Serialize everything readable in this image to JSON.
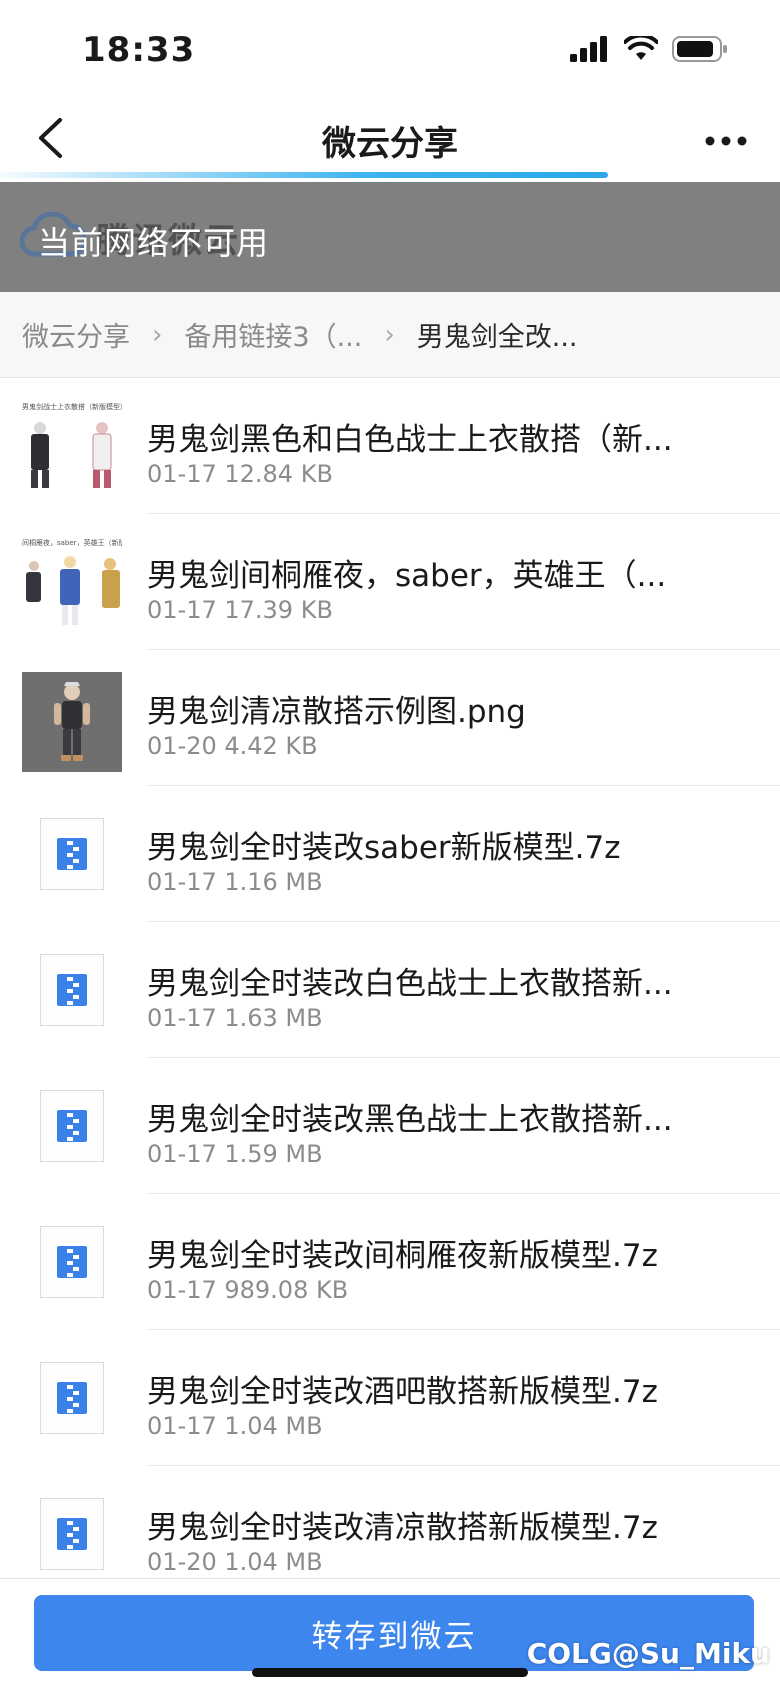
{
  "status_bar": {
    "time": "18:33"
  },
  "nav": {
    "title": "微云分享"
  },
  "loading_progress": 0.78,
  "banner": {
    "watermark": "腾讯微云",
    "message": "当前网络不可用"
  },
  "breadcrumb": {
    "items": [
      "微云分享",
      "备用链接3（...",
      "男鬼剑全改..."
    ],
    "separator": "›"
  },
  "files": [
    {
      "name": "男鬼剑黑色和白色战士上衣散搭（新...",
      "meta": "01-17 12.84 KB",
      "icon": "image-thumbnail",
      "thumb_caption": "男鬼剑战士上衣散搭（新版模型）"
    },
    {
      "name": "男鬼剑间桐雁夜，saber，英雄王（...",
      "meta": "01-17 17.39 KB",
      "icon": "image-thumbnail",
      "thumb_caption": "间桐雁夜，saber，英雄王（新版模型）"
    },
    {
      "name": "男鬼剑清凉散搭示例图.png",
      "meta": "01-20 4.42 KB",
      "icon": "image-thumbnail"
    },
    {
      "name": "男鬼剑全时装改saber新版模型.7z",
      "meta": "01-17 1.16 MB",
      "icon": "zip-file-icon"
    },
    {
      "name": "男鬼剑全时装改白色战士上衣散搭新...",
      "meta": "01-17 1.63 MB",
      "icon": "zip-file-icon"
    },
    {
      "name": "男鬼剑全时装改黑色战士上衣散搭新...",
      "meta": "01-17 1.59 MB",
      "icon": "zip-file-icon"
    },
    {
      "name": "男鬼剑全时装改间桐雁夜新版模型.7z",
      "meta": "01-17 989.08 KB",
      "icon": "zip-file-icon"
    },
    {
      "name": "男鬼剑全时装改酒吧散搭新版模型.7z",
      "meta": "01-17 1.04 MB",
      "icon": "zip-file-icon"
    },
    {
      "name": "男鬼剑全时装改清凉散搭新版模型.7z",
      "meta": "01-20 1.04 MB",
      "icon": "zip-file-icon"
    }
  ],
  "actions": {
    "save_label": "转存到微云"
  },
  "watermark": "COLG@Su_Miku",
  "colors": {
    "accent": "#3d86ee",
    "banner": "#808080",
    "progress": "#3cb4ef"
  }
}
